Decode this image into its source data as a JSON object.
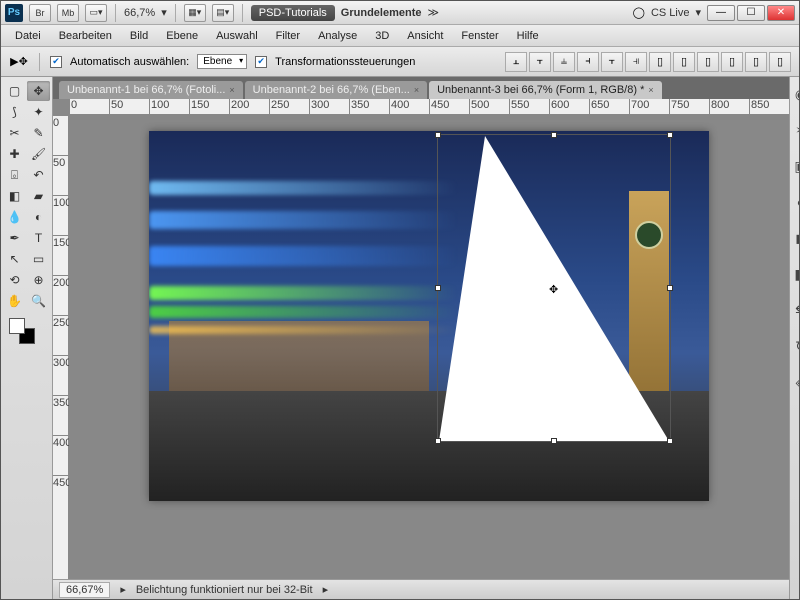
{
  "app": {
    "icon_letters": "Ps",
    "zoom_display": "66,7%",
    "psd_tut": "PSD-Tutorials",
    "grundelemente": "Grundelemente",
    "cs_live": "CS Live"
  },
  "titlebar_btns": [
    "Br",
    "Mb"
  ],
  "menu": [
    "Datei",
    "Bearbeiten",
    "Bild",
    "Ebene",
    "Auswahl",
    "Filter",
    "Analyse",
    "3D",
    "Ansicht",
    "Fenster",
    "Hilfe"
  ],
  "optbar": {
    "auto_select": "Automatisch auswählen:",
    "auto_select_value": "Ebene",
    "transform": "Transformationssteuerungen"
  },
  "tabs": [
    {
      "label": "Unbenannt-1 bei 66,7% (Fotoli...",
      "active": false
    },
    {
      "label": "Unbenannt-2 bei 66,7% (Eben...",
      "active": false
    },
    {
      "label": "Unbenannt-3 bei 66,7% (Form 1, RGB/8) *",
      "active": true
    }
  ],
  "ruler_h": [
    "0",
    "50",
    "100",
    "150",
    "200",
    "250",
    "300",
    "350",
    "400",
    "450",
    "500",
    "550",
    "600",
    "650",
    "700",
    "750",
    "800",
    "850"
  ],
  "ruler_v": [
    "0",
    "50",
    "100",
    "150",
    "200",
    "250",
    "300",
    "350",
    "400",
    "450"
  ],
  "status": {
    "zoom": "66,67%",
    "msg": "Belichtung funktioniert nur bei 32-Bit"
  },
  "tool_names": [
    "move",
    "marquee",
    "lasso",
    "wand",
    "crop",
    "eyedropper",
    "heal",
    "brush",
    "stamp",
    "history",
    "eraser",
    "gradient",
    "blur",
    "dodge",
    "pen",
    "type",
    "path",
    "shape",
    "hand",
    "zoom",
    "3d-rotate",
    "3d-orbit"
  ],
  "right_icons": [
    "color",
    "swatch",
    "adjust",
    "mask",
    "layer",
    "channel",
    "path2",
    "history2",
    "library"
  ]
}
